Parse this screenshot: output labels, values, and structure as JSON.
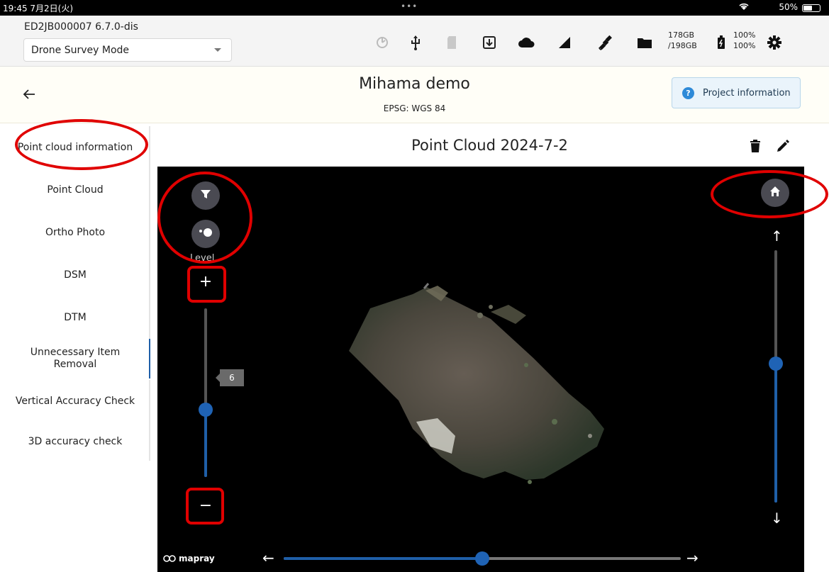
{
  "status_bar": {
    "time": "19:45  7月2日(火)",
    "dots": "•••",
    "wifi_icon": "wifi-icon",
    "battery": "50%"
  },
  "toolbar": {
    "device_id": "ED2JB000007    6.7.0-dis",
    "mode_value": "Drone Survey Mode",
    "storage_line1": "178GB",
    "storage_line2": "/198GB",
    "battery_line1": "100%",
    "battery_line2": "100%",
    "icons": [
      "timer-icon",
      "usb-icon",
      "sd-card-icon",
      "download-icon",
      "cloud-icon",
      "signal-icon",
      "satellite-icon",
      "folder-icon",
      "battery-icon",
      "gear-icon"
    ]
  },
  "project": {
    "title": "Mihama demo",
    "epsg": "EPSG: WGS 84",
    "info_button": "Project information",
    "help_icon": "?"
  },
  "sidebar": {
    "items": [
      {
        "label": "Point cloud information"
      },
      {
        "label": "Point Cloud"
      },
      {
        "label": "Ortho Photo"
      },
      {
        "label": "DSM"
      },
      {
        "label": "DTM"
      },
      {
        "label": "Unnecessary Item Removal"
      },
      {
        "label": "Vertical Accuracy Check"
      },
      {
        "label": "3D accuracy check"
      }
    ],
    "active_index": 5
  },
  "point_cloud": {
    "title": "Point Cloud 2024-7-2"
  },
  "viewer": {
    "level_label": "Level",
    "level_value": "6",
    "level_fraction": 0.4,
    "vertical_fraction": 0.55,
    "horizontal_fraction": 0.5,
    "logo": "mapray",
    "plus": "+",
    "minus": "−",
    "arrow_up": "↑",
    "arrow_down": "↓",
    "arrow_left": "←",
    "arrow_right": "→"
  },
  "colors": {
    "accent": "#1f5fa8",
    "annotation": "#e00000",
    "viewer_bg": "#000000"
  }
}
